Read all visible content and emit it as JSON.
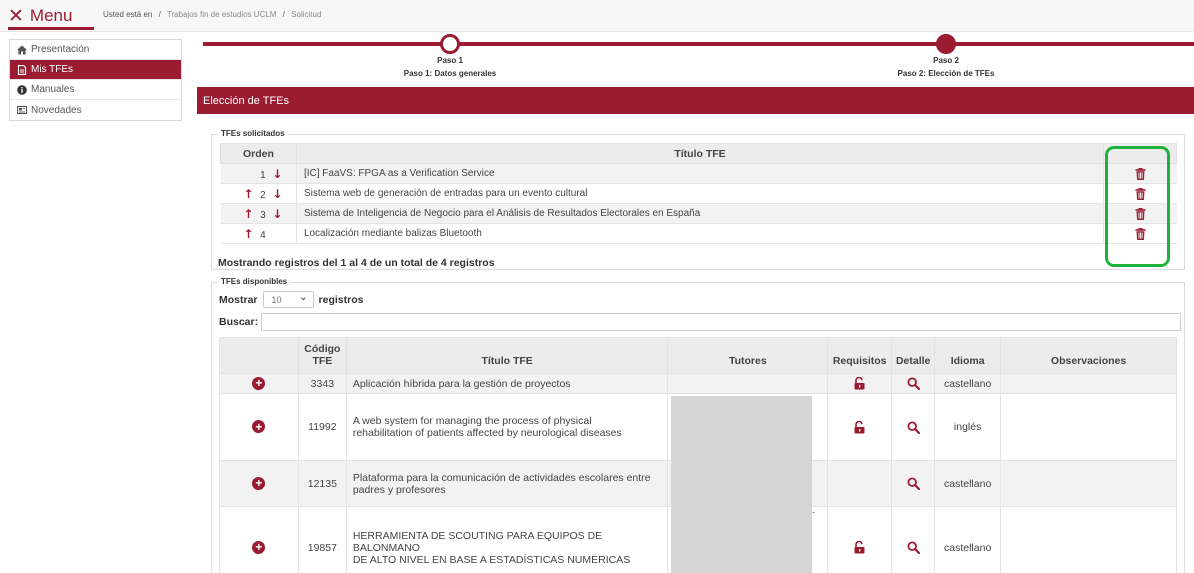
{
  "header": {
    "menu_label": "Menu",
    "breadcrumb_lead": "Usted está en",
    "breadcrumb_sep": "/",
    "breadcrumb_1": "Trabajos fin de estudios UCLM",
    "breadcrumb_2": "Solicitud"
  },
  "sidebar": {
    "items": [
      {
        "label": "Presentación",
        "icon": "home-icon"
      },
      {
        "label": "Mis TFEs",
        "icon": "document-icon"
      },
      {
        "label": "Manuales",
        "icon": "info-icon"
      },
      {
        "label": "Novedades",
        "icon": "news-icon"
      }
    ]
  },
  "stepper": {
    "step1_title": "Paso 1",
    "step1_sub": "Paso 1: Datos generales",
    "step2_title": "Paso 2",
    "step2_sub": "Paso 2: Elección de TFEs"
  },
  "section_title": "Elección de TFEs",
  "solicitados": {
    "legend": "TFEs solicitados",
    "headers": {
      "order": "Orden",
      "title": "Título TFE"
    },
    "rows": [
      {
        "order": "1",
        "title": "[IC] FaaVS: FPGA as a Verification Service"
      },
      {
        "order": "2",
        "title": "Sistema web de generación de entradas para un evento cultural"
      },
      {
        "order": "3",
        "title": "Sistema de Inteligencia de Negocio para el Análisis de Resultados Electorales en España"
      },
      {
        "order": "4",
        "title": "Localización mediante balizas Bluetooth"
      }
    ],
    "info": "Mostrando registros del 1 al 4 de un total de 4 registros"
  },
  "disponibles": {
    "legend": "TFEs disponibles",
    "show_label": "Mostrar",
    "show_value": "10",
    "records_label": "registros",
    "search_label": "Buscar:",
    "headers": {
      "code_line1": "Código",
      "code_line2": "TFE",
      "title": "Título TFE",
      "tutors": "Tutores",
      "requirements": "Requisitos",
      "detail": "Detalle",
      "language": "Idioma",
      "notes": "Observaciones"
    },
    "rows": [
      {
        "code": "3343",
        "title_1": "Aplicación híbrida para la gestión de proyectos",
        "title_2": "",
        "language": "castellano"
      },
      {
        "code": "11992",
        "title_1": "A web system for managing the process of physical",
        "title_2": "rehabilitation of patients affected by neurological diseases",
        "language": "inglés"
      },
      {
        "code": "12135",
        "title_1": "Plataforma para la comunicación de actividades escolares entre",
        "title_2": "padres y profesores",
        "language": "castellano"
      },
      {
        "code": "19857",
        "title_1": "HERRAMIENTA DE SCOUTING PARA EQUIPOS DE BALONMANO",
        "title_2": "DE ALTO NIVEL EN BASE A ESTADÍSTICAS NUMÉRICAS",
        "language": "castellano"
      }
    ]
  },
  "colors": {
    "brand": "#9b1c31",
    "highlight": "#1db33a"
  },
  "icons": {
    "up": "↑",
    "down": "↓",
    "plus": "+",
    "chevron": "⌄"
  }
}
